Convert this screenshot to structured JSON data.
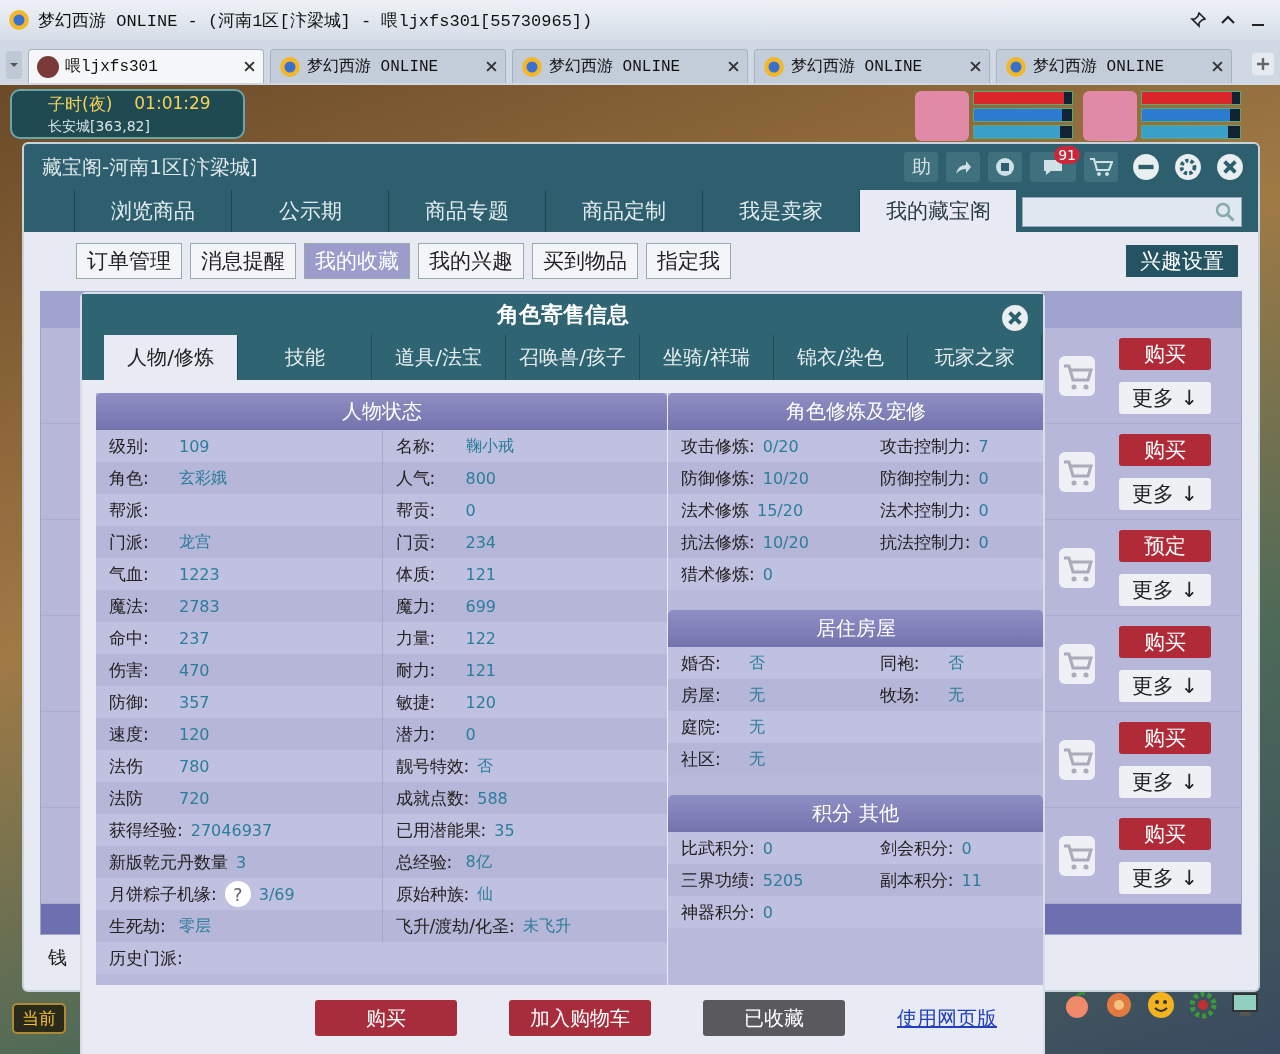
{
  "window": {
    "title": "梦幻西游 ONLINE - (河南1区[汴梁城] - 喂ljxfs301[55730965])"
  },
  "tabs": [
    {
      "label": "喂ljxfs301",
      "kind": "avatar",
      "selected": true
    },
    {
      "label": "梦幻西游 ONLINE",
      "kind": "emblem",
      "selected": false
    },
    {
      "label": "梦幻西游 ONLINE",
      "kind": "emblem",
      "selected": false
    },
    {
      "label": "梦幻西游 ONLINE",
      "kind": "emblem",
      "selected": false
    },
    {
      "label": "梦幻西游 ONLINE",
      "kind": "emblem",
      "selected": false
    }
  ],
  "hud": {
    "period": "子时(夜)",
    "clock": "01:01:29",
    "location": "长安城[363,82]",
    "current_button": "当前"
  },
  "party": [
    {
      "bars": [
        {
          "kind": "hp",
          "level": 0.92
        },
        {
          "kind": "mp",
          "level": 0.9
        },
        {
          "kind": "sp",
          "level": 0.88
        }
      ]
    },
    {
      "bars": [
        {
          "kind": "hp",
          "level": 0.92
        },
        {
          "kind": "mp",
          "level": 0.9
        },
        {
          "kind": "sp",
          "level": 0.88
        }
      ]
    }
  ],
  "shop": {
    "title": "藏宝阁-河南1区[汴梁城]",
    "help_button": "助",
    "message_count": "91",
    "tabs": [
      {
        "label": "浏览商品",
        "selected": false
      },
      {
        "label": "公示期",
        "selected": false
      },
      {
        "label": "商品专题",
        "selected": false
      },
      {
        "label": "商品定制",
        "selected": false
      },
      {
        "label": "我是卖家",
        "selected": false
      },
      {
        "label": "我的藏宝阁",
        "selected": true
      }
    ],
    "subtabs": [
      {
        "label": "订单管理",
        "selected": false
      },
      {
        "label": "消息提醒",
        "selected": false
      },
      {
        "label": "我的收藏",
        "selected": true
      },
      {
        "label": "我的兴趣",
        "selected": false
      },
      {
        "label": "买到物品",
        "selected": false
      },
      {
        "label": "指定我",
        "selected": false
      }
    ],
    "interest_button": "兴趣设置",
    "listing_actions": [
      {
        "primary": "购买",
        "more": "更多 ↓"
      },
      {
        "primary": "购买",
        "more": "更多 ↓"
      },
      {
        "primary": "预定",
        "more": "更多 ↓"
      },
      {
        "primary": "购买",
        "more": "更多 ↓"
      },
      {
        "primary": "购买",
        "more": "更多 ↓"
      },
      {
        "primary": "购买",
        "more": "更多 ↓"
      }
    ],
    "footer_label": "钱"
  },
  "dialog": {
    "title": "角色寄售信息",
    "tabs": [
      {
        "label": "人物/修炼",
        "selected": true
      },
      {
        "label": "技能",
        "selected": false
      },
      {
        "label": "道具/法宝",
        "selected": false
      },
      {
        "label": "召唤兽/孩子",
        "selected": false
      },
      {
        "label": "坐骑/祥瑞",
        "selected": false
      },
      {
        "label": "锦衣/染色",
        "selected": false
      },
      {
        "label": "玩家之家",
        "selected": false
      }
    ],
    "left_section": {
      "title": "人物状态",
      "rows": [
        [
          {
            "label": "级别:",
            "value": "109"
          },
          {
            "label": "名称:",
            "value": "鞠小戒"
          }
        ],
        [
          {
            "label": "角色:",
            "value": "玄彩娥"
          },
          {
            "label": "人气:",
            "value": "800"
          }
        ],
        [
          {
            "label": "帮派:"
          },
          {
            "label": "帮贡:",
            "value": "0"
          }
        ],
        [
          {
            "label": "门派:",
            "value": "龙宫"
          },
          {
            "label": "门贡:",
            "value": "234"
          }
        ],
        [
          {
            "label": "气血:",
            "value": "1223"
          },
          {
            "label": "体质:",
            "value": "121"
          }
        ],
        [
          {
            "label": "魔法:",
            "value": "2783"
          },
          {
            "label": "魔力:",
            "value": "699"
          }
        ],
        [
          {
            "label": "命中:",
            "value": "237"
          },
          {
            "label": "力量:",
            "value": "122"
          }
        ],
        [
          {
            "label": "伤害:",
            "value": "470"
          },
          {
            "label": "耐力:",
            "value": "121"
          }
        ],
        [
          {
            "label": "防御:",
            "value": "357"
          },
          {
            "label": "敏捷:",
            "value": "120"
          }
        ],
        [
          {
            "label": "速度:",
            "value": "120"
          },
          {
            "label": "潜力:",
            "value": "0"
          }
        ],
        [
          {
            "label": "法伤",
            "value": "780"
          },
          {
            "label": "靓号特效:",
            "value": "否"
          }
        ],
        [
          {
            "label": "法防",
            "value": "720"
          },
          {
            "label": "成就点数:",
            "value": "588"
          }
        ],
        [
          {
            "label": "获得经验:",
            "value": "27046937"
          },
          {
            "label": "已用潜能果:",
            "value": "35"
          }
        ],
        [
          {
            "label": "新版乾元丹数量",
            "value": "3"
          },
          {
            "label": "总经验:",
            "value": "8亿"
          }
        ],
        [
          {
            "label": "月饼粽子机缘:",
            "hint": "?",
            "value": "3/69"
          },
          {
            "label": "原始种族:",
            "value": "仙"
          }
        ],
        [
          {
            "label": "生死劫:",
            "value": "零层"
          },
          {
            "label": "飞升/渡劫/化圣:",
            "value": "未飞升"
          }
        ],
        [
          {
            "label": "历史门派:"
          }
        ]
      ]
    },
    "right_sections": [
      {
        "title": "角色修炼及宠修",
        "rows": [
          [
            {
              "label": "攻击修炼:",
              "value": "0/20"
            },
            {
              "label": "攻击控制力:",
              "value": "7"
            }
          ],
          [
            {
              "label": "防御修炼:",
              "value": "10/20"
            },
            {
              "label": "防御控制力:",
              "value": "0"
            }
          ],
          [
            {
              "label": "法术修炼",
              "value": "15/20"
            },
            {
              "label": "法术控制力:",
              "value": "0"
            }
          ],
          [
            {
              "label": "抗法修炼:",
              "value": "10/20"
            },
            {
              "label": "抗法控制力:",
              "value": "0"
            }
          ],
          [
            {
              "label": "猎术修炼:",
              "value": "0"
            }
          ]
        ]
      },
      {
        "title": "居住房屋",
        "rows": [
          [
            {
              "label": "婚否:",
              "value": "否"
            },
            {
              "label": "同袍:",
              "value": "否"
            }
          ],
          [
            {
              "label": "房屋:",
              "value": "无"
            },
            {
              "label": "牧场:",
              "value": "无"
            }
          ],
          [
            {
              "label": "庭院:",
              "value": "无"
            }
          ],
          [
            {
              "label": "社区:",
              "value": "无"
            }
          ]
        ]
      },
      {
        "title": "积分 其他",
        "rows": [
          [
            {
              "label": "比武积分:",
              "value": "0"
            },
            {
              "label": "剑会积分:",
              "value": "0"
            }
          ],
          [
            {
              "label": "三界功绩:",
              "value": "5205"
            },
            {
              "label": "副本积分:",
              "value": "11"
            }
          ],
          [
            {
              "label": "神器积分:",
              "value": "0"
            }
          ]
        ]
      }
    ],
    "buttons": [
      {
        "label": "购买",
        "kind": "action"
      },
      {
        "label": "加入购物车",
        "kind": "action"
      },
      {
        "label": "已收藏",
        "kind": "inactive"
      },
      {
        "label": "使用网页版",
        "kind": "link"
      }
    ]
  }
}
